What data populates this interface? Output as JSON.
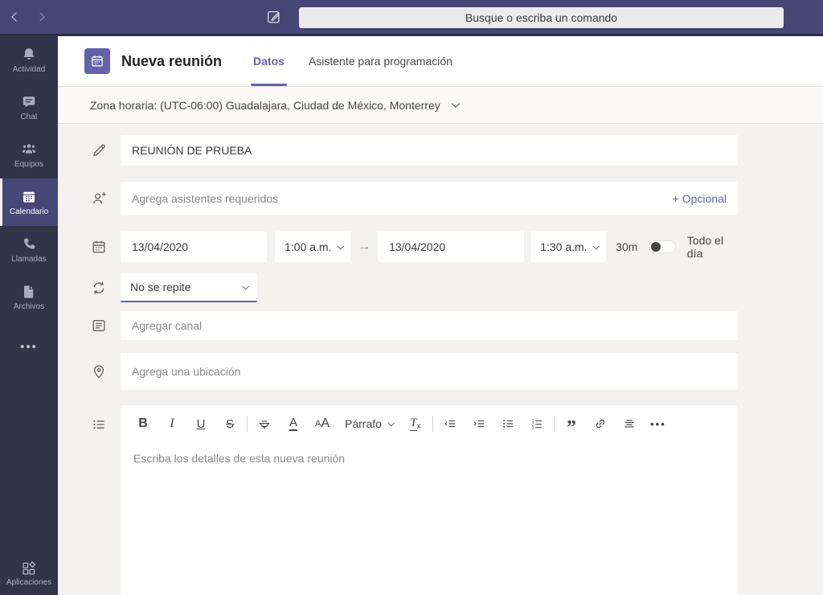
{
  "topbar": {
    "search_placeholder": "Busque o escriba un comando"
  },
  "sidebar": {
    "items": [
      {
        "label": "Actividad",
        "icon": "bell"
      },
      {
        "label": "Chat",
        "icon": "chat-bubble"
      },
      {
        "label": "Equipos",
        "icon": "people"
      },
      {
        "label": "Calendario",
        "icon": "calendar",
        "active": true
      },
      {
        "label": "Llamadas",
        "icon": "phone"
      },
      {
        "label": "Archivos",
        "icon": "document"
      }
    ],
    "more_label": "•••",
    "apps_label": "Aplicaciones"
  },
  "header": {
    "title": "Nueva reunión",
    "tabs": [
      {
        "label": "Datos",
        "active": true
      },
      {
        "label": "Asistente para programación",
        "active": false
      }
    ]
  },
  "timezone_label": "Zona horaria: (UTC-06:00) Guadalajara, Ciudad de México, Monterrey",
  "form": {
    "title_value": "REUNIÓN DE PRUEBA",
    "attendees_placeholder": "Agrega asistentes requeridos",
    "optional_label": "+ Opcional",
    "start_date": "13/04/2020",
    "start_time": "1:00 a.m.",
    "arrow_glyph": "→",
    "end_date": "13/04/2020",
    "end_time": "1:30 a.m.",
    "duration": "30m",
    "all_day_label": "Todo el día",
    "repeat_value": "No se repite",
    "channel_placeholder": "Agregar canal",
    "location_placeholder": "Agrega una ubicación",
    "description_placeholder": "Escriba los detalles de esta nueva reunión"
  },
  "toolbar": {
    "bold_glyph": "B",
    "italic_glyph": "I",
    "underline_glyph": "U",
    "strikethrough_glyph": "S",
    "font_color_glyph": "A",
    "font_size_small_glyph": "A",
    "font_size_large_glyph": "A",
    "paragraph_label": "Párrafo",
    "clear_format_t_glyph": "T",
    "clear_format_x_glyph": "x",
    "quote_glyph": "”",
    "more_glyph": "•••"
  },
  "icons": {
    "back": "chevron-left",
    "forward": "chevron-right",
    "compose": "new-chat-pencil",
    "meeting_header": "calendar",
    "timezone_expand": "chevron-down",
    "title_row": "pencil",
    "attendees_row": "person-add",
    "date_row": "calendar",
    "repeat_row": "circular-arrows",
    "channel_row": "channel-list",
    "location_row": "map-pin",
    "description_row": "list-details",
    "toolbar_icons": [
      "bold",
      "italic",
      "underline",
      "strikethrough",
      "highlighter",
      "font-color",
      "font-size",
      "paragraph-dropdown",
      "clear-formatting",
      "outdent",
      "indent",
      "bulleted-list",
      "numbered-list",
      "quote",
      "link",
      "horizontal-rule",
      "more"
    ]
  },
  "colors": {
    "topbar": "#464775",
    "sidebar": "#33344a",
    "accent": "#6264a7",
    "content_bg": "#f3f2f1",
    "field_bg": "#ffffff",
    "text": "#252423",
    "muted_text": "#8a8886"
  }
}
